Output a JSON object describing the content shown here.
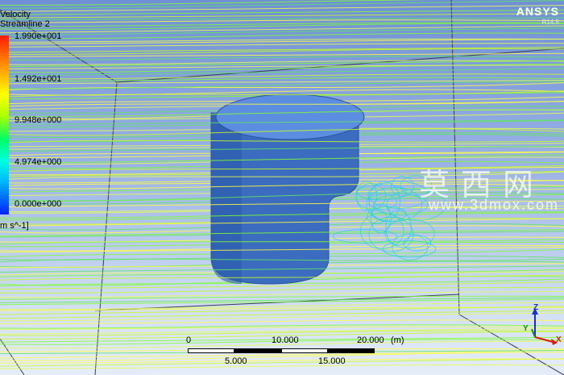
{
  "legend": {
    "title_line1": "Velocity",
    "title_line2": "Streamline 2",
    "ticks": [
      "1.990e+001",
      "1.492e+001",
      "9.948e+000",
      "4.974e+000",
      "0.000e+000"
    ],
    "units": "m s^-1]"
  },
  "brand": {
    "name": "ANSYS",
    "version": "R14.5"
  },
  "watermark": {
    "text": "莫西网",
    "url": "www.3dmox.com"
  },
  "scale": {
    "top_labels": [
      "0",
      "10.000",
      "20.000"
    ],
    "unit": "(m)",
    "bottom_labels": [
      "5.000",
      "15.000"
    ]
  },
  "axes": {
    "z": "Z",
    "y": "Y",
    "x": "X"
  },
  "colors": {
    "streamline_high": "#ffff40",
    "streamline_mid": "#7fff30",
    "streamline_low": "#20c8ff",
    "cylinder": "#3f74c9"
  }
}
